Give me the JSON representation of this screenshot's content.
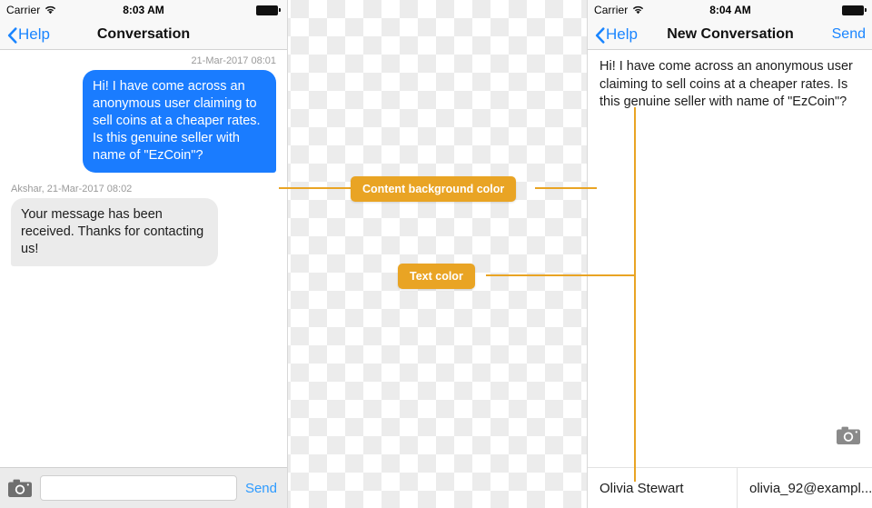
{
  "left_phone": {
    "status": {
      "carrier": "Carrier",
      "wifi_icon": "wifi-icon",
      "time": "8:03 AM",
      "battery_icon": "battery-full-icon"
    },
    "nav": {
      "back_icon": "chevron-left-icon",
      "back_label": "Help",
      "title": "Conversation"
    },
    "messages": [
      {
        "meta": "21-Mar-2017 08:01",
        "text": "Hi! I have come across an anonymous user claiming to sell coins at a cheaper rates. Is this genuine seller with name of \"EzCoin\"?",
        "direction": "outgoing"
      },
      {
        "meta": "Akshar, 21-Mar-2017 08:02",
        "text": "Your message has been received. Thanks for contacting us!",
        "direction": "incoming"
      }
    ],
    "toolbar": {
      "camera_icon": "camera-icon",
      "input_value": "",
      "input_placeholder": "",
      "send_label": "Send"
    }
  },
  "right_phone": {
    "status": {
      "carrier": "Carrier",
      "wifi_icon": "wifi-icon",
      "time": "8:04 AM",
      "battery_icon": "battery-full-icon"
    },
    "nav": {
      "back_icon": "chevron-left-icon",
      "back_label": "Help",
      "title": "New Conversation",
      "send_label": "Send"
    },
    "compose": {
      "text": "Hi! I have come across an anonymous user claiming to sell coins at a cheaper rates. Is this genuine seller with name of \"EzCoin\"?",
      "camera_icon": "camera-icon"
    },
    "recipient": {
      "name": "Olivia Stewart",
      "email": "olivia_92@exampl..."
    }
  },
  "annotations": {
    "content_background": "Content background color",
    "text_color": "Text color"
  },
  "colors": {
    "annotation": "#e9a424",
    "outgoing_bubble": "#1a7cff",
    "incoming_bubble": "#ebebeb",
    "link_blue": "#1a85ff",
    "nav_bar": "#f8f8f8",
    "toolbar": "#ebebeb"
  }
}
